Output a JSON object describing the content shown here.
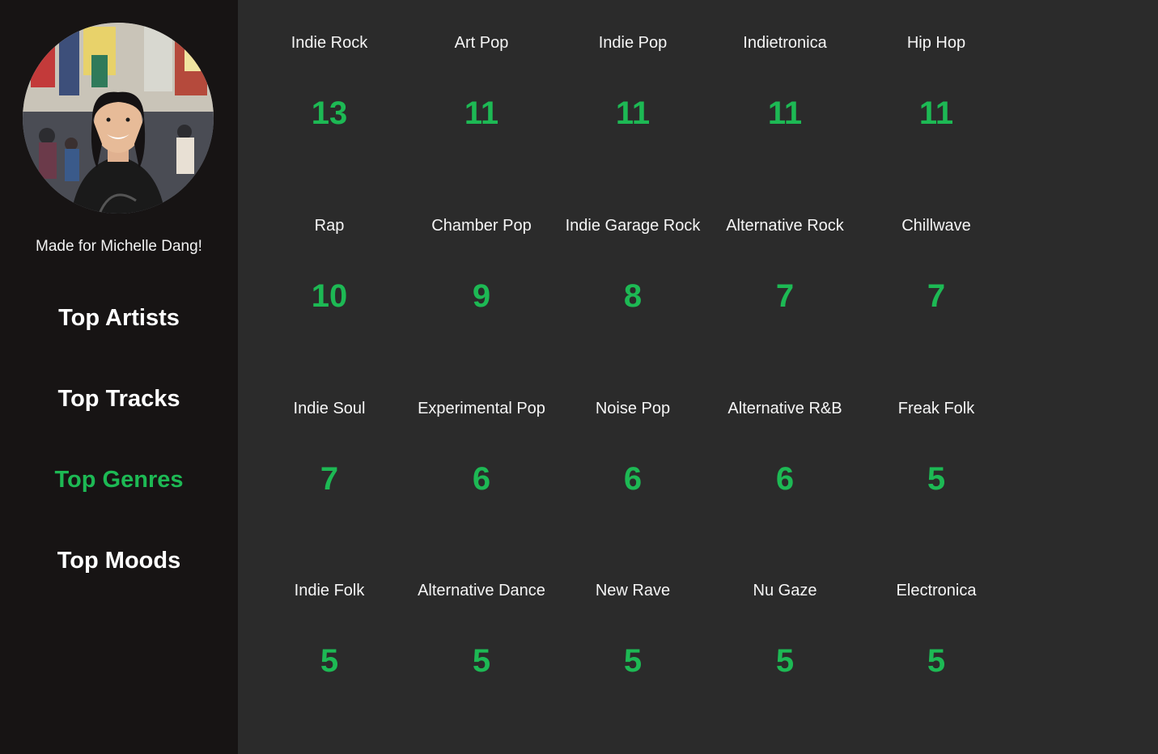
{
  "sidebar": {
    "made_for": "Made for Michelle Dang!",
    "nav": [
      {
        "label": "Top Artists",
        "active": false
      },
      {
        "label": "Top Tracks",
        "active": false
      },
      {
        "label": "Top Genres",
        "active": true
      },
      {
        "label": "Top Moods",
        "active": false
      }
    ]
  },
  "colors": {
    "accent": "#1db954",
    "sidebar_bg": "#171414",
    "main_bg": "#2b2b2b"
  },
  "genres": [
    {
      "name": "Indie Rock",
      "count": "13"
    },
    {
      "name": "Art Pop",
      "count": "11"
    },
    {
      "name": "Indie Pop",
      "count": "11"
    },
    {
      "name": "Indietronica",
      "count": "11"
    },
    {
      "name": "Hip Hop",
      "count": "11"
    },
    {
      "name": "Rap",
      "count": "10"
    },
    {
      "name": "Chamber Pop",
      "count": "9"
    },
    {
      "name": "Indie Garage Rock",
      "count": "8"
    },
    {
      "name": "Alternative Rock",
      "count": "7"
    },
    {
      "name": "Chillwave",
      "count": "7"
    },
    {
      "name": "Indie Soul",
      "count": "7"
    },
    {
      "name": "Experimental Pop",
      "count": "6"
    },
    {
      "name": "Noise Pop",
      "count": "6"
    },
    {
      "name": "Alternative R&B",
      "count": "6"
    },
    {
      "name": "Freak Folk",
      "count": "5"
    },
    {
      "name": "Indie Folk",
      "count": "5"
    },
    {
      "name": "Alternative Dance",
      "count": "5"
    },
    {
      "name": "New Rave",
      "count": "5"
    },
    {
      "name": "Nu Gaze",
      "count": "5"
    },
    {
      "name": "Electronica",
      "count": "5"
    }
  ]
}
